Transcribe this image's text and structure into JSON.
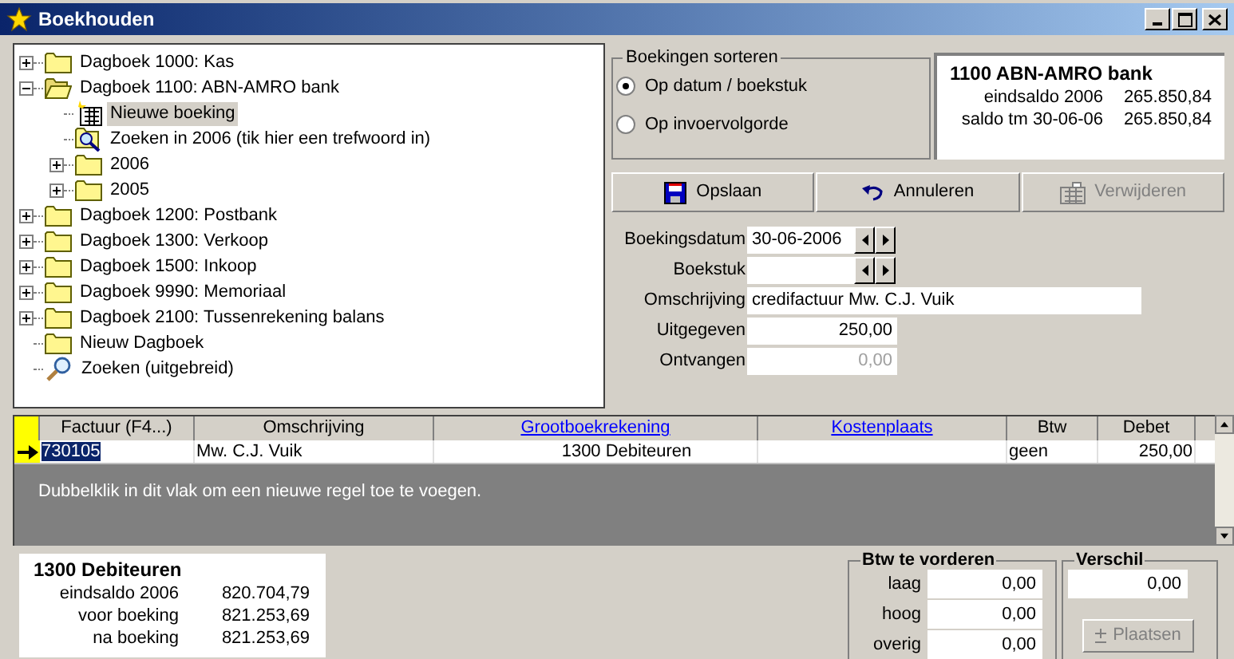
{
  "window": {
    "title": "Boekhouden"
  },
  "tree": [
    {
      "label": "Dagboek 1000: Kas",
      "kind": "folder",
      "expanded": false,
      "selected": false
    },
    {
      "label": "Dagboek 1100: ABN-AMRO bank",
      "kind": "folder",
      "expanded": true,
      "selected": false,
      "children": [
        {
          "label": "Nieuwe boeking",
          "kind": "entry",
          "selected": true
        },
        {
          "label": "Zoeken in 2006 (tik hier een trefwoord in)",
          "kind": "query",
          "selected": false
        },
        {
          "label": "2006",
          "kind": "folder",
          "expanded": false,
          "selected": false
        },
        {
          "label": "2005",
          "kind": "folder",
          "expanded": false,
          "selected": false
        }
      ]
    },
    {
      "label": "Dagboek 1200: Postbank",
      "kind": "folder",
      "expanded": false,
      "selected": false
    },
    {
      "label": "Dagboek 1300: Verkoop",
      "kind": "folder",
      "expanded": false,
      "selected": false
    },
    {
      "label": "Dagboek 1500: Inkoop",
      "kind": "folder",
      "expanded": false,
      "selected": false
    },
    {
      "label": "Dagboek 9990: Memoriaal",
      "kind": "folder",
      "expanded": false,
      "selected": false
    },
    {
      "label": "Dagboek 2100: Tussenrekening balans",
      "kind": "folder",
      "expanded": false,
      "selected": false
    },
    {
      "label": "Nieuw Dagboek",
      "kind": "folder",
      "selected": false
    },
    {
      "label": "Zoeken (uitgebreid)",
      "kind": "search",
      "selected": false
    }
  ],
  "sort_group": {
    "title": "Boekingen sorteren",
    "options": [
      {
        "label": "Op datum / boekstuk",
        "selected": true
      },
      {
        "label": "Op invoervolgorde",
        "selected": false
      }
    ]
  },
  "account_summary": {
    "title": "1100 ABN-AMRO bank",
    "rows": [
      {
        "label": "eindsaldo 2006",
        "value": "265.850,84"
      },
      {
        "label": "saldo tm 30-06-06",
        "value": "265.850,84"
      }
    ]
  },
  "toolbar": [
    {
      "label": "Opslaan",
      "kind": "save",
      "disabled": false
    },
    {
      "label": "Annuleren",
      "kind": "undo",
      "disabled": false
    },
    {
      "label": "Verwijderen",
      "kind": "delete",
      "disabled": true
    }
  ],
  "form": [
    {
      "label": "Boekingsdatum",
      "kind": "spin",
      "value": "30-06-2006"
    },
    {
      "label": "Boekstuk",
      "kind": "spin"
    },
    {
      "label": "Omschrijving",
      "kind": "text",
      "value": "credifactuur Mw. C.J. Vuik"
    },
    {
      "label": "Uitgegeven",
      "kind": "amount",
      "value": "250,00"
    },
    {
      "label": "Ontvangen",
      "kind": "amount",
      "placeholder": "0,00"
    }
  ],
  "grid": {
    "columns": [
      {
        "label": "Factuur (F4...)",
        "link": false
      },
      {
        "label": "Omschrijving",
        "link": false
      },
      {
        "label": "Grootboekrekening",
        "link": true
      },
      {
        "label": "Kostenplaats",
        "link": true
      },
      {
        "label": "Btw",
        "link": false
      },
      {
        "label": "Debet",
        "link": false
      }
    ],
    "rows": [
      {
        "current": true,
        "cells": [
          {
            "text": "730105",
            "selected": true
          },
          {
            "text": "Mw. C.J. Vuik",
            "selected": false
          },
          {
            "text": "1300 Debiteuren",
            "selected": false
          },
          {
            "selected": false
          },
          {
            "text": "geen",
            "selected": false
          },
          {
            "text": "250,00",
            "selected": false
          }
        ]
      }
    ],
    "hint": "Dubbelklik in dit vlak om een nieuwe regel toe te voegen."
  },
  "ledger_summary": {
    "title": "1300 Debiteuren",
    "rows": [
      {
        "label": "eindsaldo 2006",
        "value": "820.704,79"
      },
      {
        "label": "voor boeking",
        "value": "821.253,69"
      },
      {
        "label": "na boeking",
        "value": "821.253,69"
      }
    ]
  },
  "vat_group": {
    "title": "Btw te vorderen",
    "rows": [
      {
        "label": "laag",
        "value": "0,00"
      },
      {
        "label": "hoog",
        "value": "0,00"
      },
      {
        "label": "overig",
        "value": "0,00"
      }
    ]
  },
  "difference": {
    "title": "Verschil",
    "value": "0,00",
    "button": {
      "label": "Plaatsen",
      "disabled": true
    }
  }
}
